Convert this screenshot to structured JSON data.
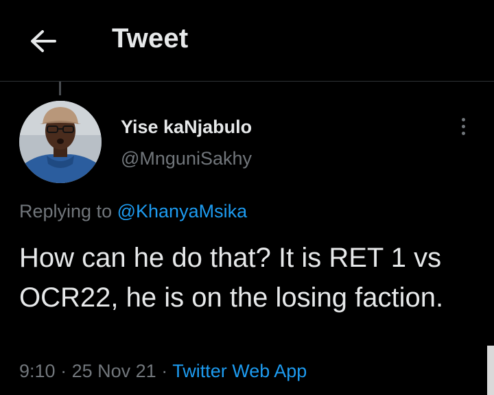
{
  "header": {
    "title": "Tweet",
    "back_icon": "arrow-left-icon"
  },
  "tweet": {
    "author": {
      "display_name": "Yise kaNjabulo",
      "handle": "@MnguniSakhy"
    },
    "replying_prefix": "Replying to",
    "replying_to": "@KhanyaMsika",
    "text": "How can he do that? It is RET 1 vs OCR22, he is on the losing faction.",
    "time": "9:10",
    "separator": "·",
    "date": "25 Nov 21",
    "source": "Twitter Web App",
    "more_icon": "more-vertical-icon"
  },
  "colors": {
    "background": "#000000",
    "text_primary": "#e7e9ea",
    "text_secondary": "#71767b",
    "link": "#1d9bf0",
    "divider": "#2f3336"
  }
}
